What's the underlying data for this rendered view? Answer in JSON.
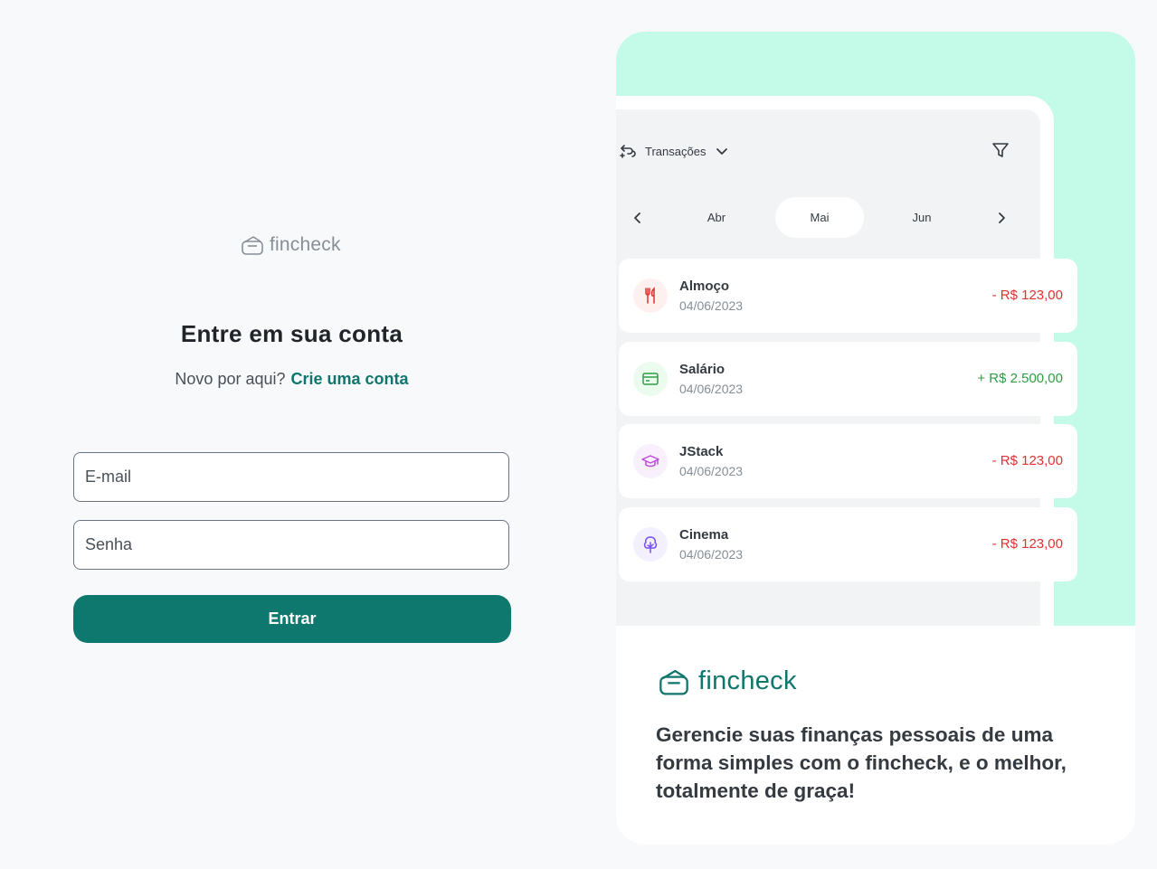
{
  "brand": {
    "name": "fincheck",
    "logo_icon": "wallet-icon"
  },
  "login": {
    "title": "Entre em sua conta",
    "subtitle_prefix": "Novo por aqui?",
    "signup_link": "Crie uma conta",
    "email_placeholder": "E-mail",
    "password_placeholder": "Senha",
    "submit_label": "Entrar"
  },
  "preview": {
    "dropdown_label": "Transações",
    "months": [
      "Abr",
      "Mai",
      "Jun"
    ],
    "selected_month": "Mai",
    "transactions": [
      {
        "name": "Almoço",
        "date": "04/06/2023",
        "amount": "- R$ 123,00",
        "type": "expense",
        "icon": "food-icon"
      },
      {
        "name": "Salário",
        "date": "04/06/2023",
        "amount": "+ R$ 2.500,00",
        "type": "income",
        "icon": "card-icon"
      },
      {
        "name": "JStack",
        "date": "04/06/2023",
        "amount": "- R$ 123,00",
        "type": "expense",
        "icon": "education-icon"
      },
      {
        "name": "Cinema",
        "date": "04/06/2023",
        "amount": "- R$ 123,00",
        "type": "expense",
        "icon": "leisure-icon"
      }
    ]
  },
  "promo": {
    "text": "Gerencie suas finanças pessoais de uma forma simples com o fincheck, e o melhor, totalmente de graça!"
  },
  "colors": {
    "primary": "#0e776e",
    "mint": "#c3fae8",
    "expense": "#e03131",
    "income": "#2f9e44",
    "background": "#f8f9fa"
  }
}
